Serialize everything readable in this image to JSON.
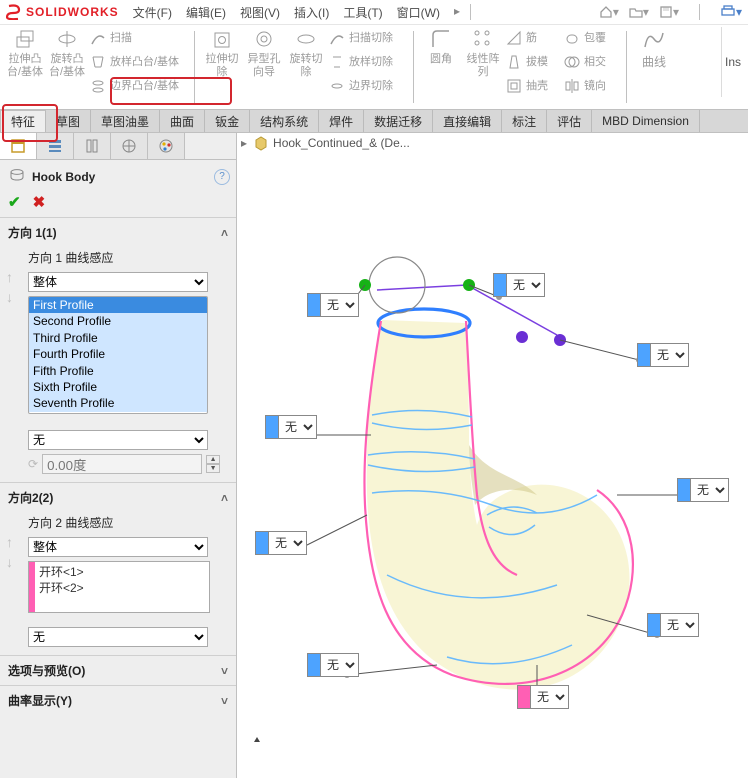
{
  "app": {
    "name": "SOLIDWORKS"
  },
  "menu": {
    "file": "文件(F)",
    "edit": "编辑(E)",
    "view": "视图(V)",
    "insert": "插入(I)",
    "tools": "工具(T)",
    "window": "窗口(W)"
  },
  "ribbon": {
    "extrude": "拉伸凸\n台/基体",
    "revolve": "旋转凸\n台/基体",
    "sweep": "扫描",
    "loft": "放样凸台/基体",
    "boundary": "边界凸台/基体",
    "cut_extrude": "拉伸切\n除",
    "hole": "异型孔\n向导",
    "cut_revolve": "旋转切\n除",
    "cut_sweep": "扫描切除",
    "cut_loft": "放样切除",
    "cut_boundary": "边界切除",
    "fillet": "圆角",
    "linear": "线性阵\n列",
    "rib": "筋",
    "draft": "拔模",
    "shell": "抽壳",
    "wrap": "包覆",
    "intersect": "相交",
    "mirror": "镜向",
    "curves": "曲线",
    "ins": "Ins"
  },
  "tabs": [
    "特征",
    "草图",
    "草图油墨",
    "曲面",
    "钣金",
    "结构系统",
    "焊件",
    "数据迁移",
    "直接编辑",
    "标注",
    "评估",
    "MBD Dimension"
  ],
  "document_tab": "Hook_Continued_& (De...",
  "feature": {
    "title": "Hook Body",
    "dir1": {
      "title": "方向 1(1)",
      "sub": "方向 1 曲线感应",
      "combo": "整体",
      "profiles": [
        "First Profile",
        "Second Profile",
        "Third Profile",
        "Fourth Profile",
        "Fifth Profile",
        "Sixth Profile",
        "Seventh Profile"
      ],
      "combo2": "无",
      "angle": "0.00度"
    },
    "dir2": {
      "title": "方向2(2)",
      "sub": "方向 2 曲线感应",
      "combo": "整体",
      "items": [
        "开环<1>",
        "开环<2>"
      ],
      "combo2": "无"
    },
    "options_title": "选项与预览(O)",
    "curvature_title": "曲率显示(Y)"
  },
  "callouts": {
    "c1": "无",
    "c2": "无",
    "c3": "无",
    "c4": "无",
    "c5": "无",
    "c6": "无",
    "c7": "无",
    "c8": "无",
    "c9": "无"
  }
}
